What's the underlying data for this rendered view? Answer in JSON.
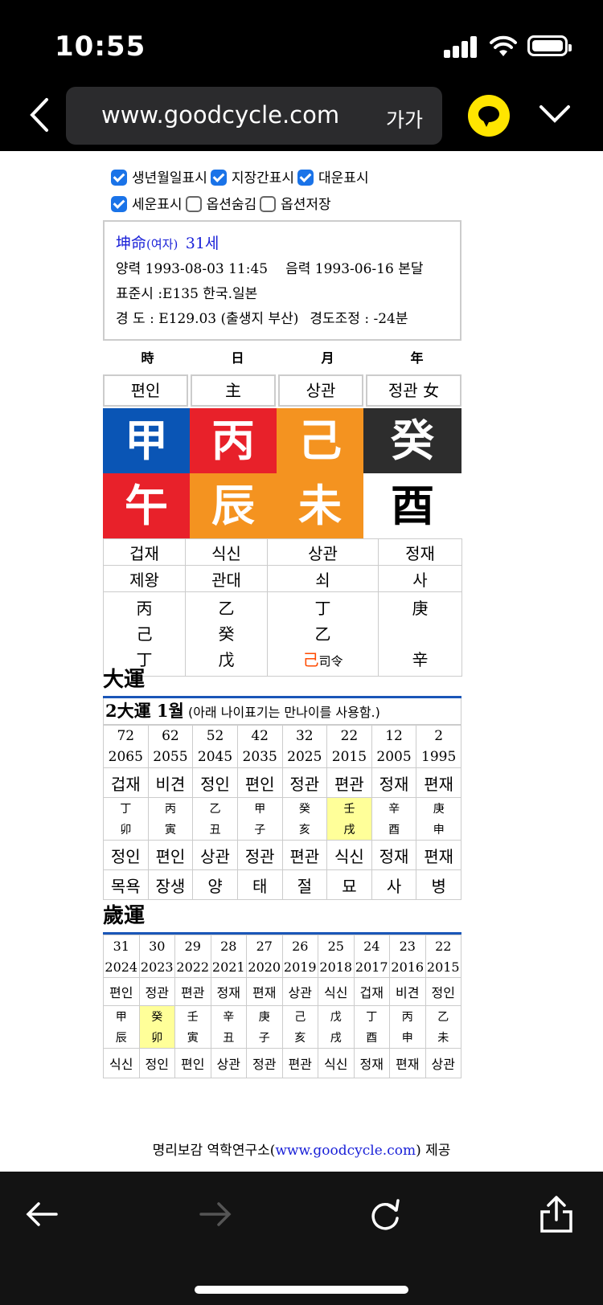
{
  "status": {
    "time": "10:55"
  },
  "browser": {
    "url": "www.goodcycle.com",
    "text_size": "가가"
  },
  "options": [
    {
      "label": "생년월일표시",
      "checked": true
    },
    {
      "label": "지장간표시",
      "checked": true
    },
    {
      "label": "대운표시",
      "checked": true
    },
    {
      "label": "세운표시",
      "checked": true
    },
    {
      "label": "옵션숨김",
      "checked": false
    },
    {
      "label": "옵션저장",
      "checked": false
    }
  ],
  "info": {
    "title": "坤命",
    "gender": "(여자)",
    "age": "31세",
    "solar": "양력 1993-08-03 11:45",
    "lunar": "음력 1993-06-16 본달",
    "standard": "표준시 :E135 한국.일본",
    "longitude": "경 도 : E129.03 (출생지 부산)",
    "adjust": "경도조정 : -24분"
  },
  "columns": [
    "時",
    "日",
    "月",
    "年"
  ],
  "pillars": {
    "top_tengods": [
      "편인",
      "主",
      "상관",
      "정관 女"
    ],
    "stems": [
      {
        "char": "甲",
        "bg": "#0a55b5",
        "fg": "#ffffff"
      },
      {
        "char": "丙",
        "bg": "#e8212a",
        "fg": "#ffffff"
      },
      {
        "char": "己",
        "bg": "#f49320",
        "fg": "#ffffff"
      },
      {
        "char": "癸",
        "bg": "#2d2d2d",
        "fg": "#ffffff"
      }
    ],
    "branches": [
      {
        "char": "午",
        "bg": "#e8212a",
        "fg": "#ffffff"
      },
      {
        "char": "辰",
        "bg": "#f49320",
        "fg": "#ffffff"
      },
      {
        "char": "未",
        "bg": "#f49320",
        "fg": "#ffffff"
      },
      {
        "char": "酉",
        "bg": "#ffffff",
        "fg": "#000000"
      }
    ],
    "branch_tengods": [
      "겁재",
      "식신",
      "상관",
      "정재"
    ],
    "stages": [
      "제왕",
      "관대",
      "쇠",
      "사"
    ],
    "hidden": [
      [
        "丙",
        "己",
        "丁"
      ],
      [
        "乙",
        "癸",
        "戊"
      ],
      [
        "丁",
        "乙",
        "己"
      ],
      [
        "庚",
        "",
        "辛"
      ]
    ],
    "hidden_note": "司令",
    "hidden_note_color": "#ff4a00"
  },
  "daewoon": {
    "header": "大運",
    "title": "2大運 1월",
    "note": "(아래 나이표기는 만나이를 사용함.)",
    "ages": [
      "72",
      "62",
      "52",
      "42",
      "32",
      "22",
      "12",
      "2"
    ],
    "years": [
      "2065",
      "2055",
      "2045",
      "2035",
      "2025",
      "2015",
      "2005",
      "1995"
    ],
    "stem_gods": [
      "겁재",
      "비견",
      "정인",
      "편인",
      "정관",
      "편관",
      "정재",
      "편재"
    ],
    "stems": [
      "丁",
      "丙",
      "乙",
      "甲",
      "癸",
      "壬",
      "辛",
      "庚"
    ],
    "branches": [
      "卯",
      "寅",
      "丑",
      "子",
      "亥",
      "戌",
      "酉",
      "申"
    ],
    "branch_gods": [
      "정인",
      "편인",
      "상관",
      "정관",
      "편관",
      "식신",
      "정재",
      "편재"
    ],
    "stages": [
      "목욕",
      "장생",
      "양",
      "태",
      "절",
      "묘",
      "사",
      "병"
    ],
    "highlight_index": 5,
    "highlight_color": "#ffff99"
  },
  "sewoon": {
    "header": "歲運",
    "ages": [
      "31",
      "30",
      "29",
      "28",
      "27",
      "26",
      "25",
      "24",
      "23",
      "22"
    ],
    "years": [
      "2024",
      "2023",
      "2022",
      "2021",
      "2020",
      "2019",
      "2018",
      "2017",
      "2016",
      "2015"
    ],
    "stem_gods": [
      "편인",
      "정관",
      "편관",
      "정재",
      "편재",
      "상관",
      "식신",
      "겁재",
      "비견",
      "정인"
    ],
    "stems": [
      "甲",
      "癸",
      "壬",
      "辛",
      "庚",
      "己",
      "戊",
      "丁",
      "丙",
      "乙"
    ],
    "branches": [
      "辰",
      "卯",
      "寅",
      "丑",
      "子",
      "亥",
      "戌",
      "酉",
      "申",
      "未"
    ],
    "branch_gods": [
      "식신",
      "정인",
      "편인",
      "상관",
      "정관",
      "편관",
      "식신",
      "정재",
      "편재",
      "상관"
    ],
    "highlight_index": 1
  },
  "footer": {
    "prefix": "명리보감 역학연구소(",
    "link": "www.goodcycle.com",
    "suffix": ") 제공"
  },
  "icons": {
    "back": "arrow-left-icon",
    "forward": "arrow-right-icon",
    "reload": "reload-icon",
    "share": "share-icon"
  }
}
